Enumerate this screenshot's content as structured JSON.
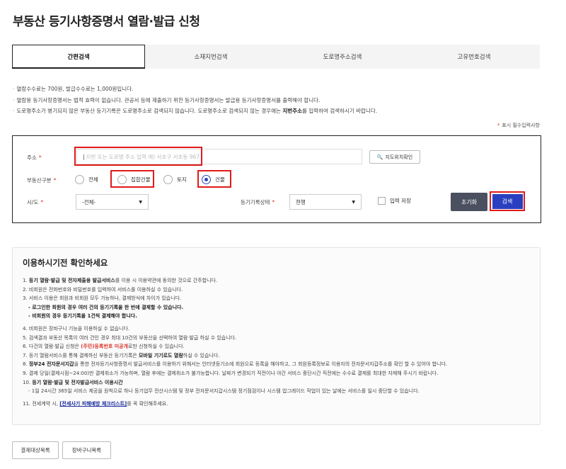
{
  "page": {
    "title": "부동산 등기사항증명서 열람·발급 신청"
  },
  "tabs": [
    {
      "label": "간편검색",
      "active": true
    },
    {
      "label": "소재지번검색",
      "active": false
    },
    {
      "label": "도로명주소검색",
      "active": false
    },
    {
      "label": "고유번호검색",
      "active": false
    }
  ],
  "notes": {
    "n1": "열람수수료는 700원, 발급수수료는 1,000원입니다.",
    "n2": "열람용 등기사항증명서는 법적 효력이 없습니다. 관공서 등에 제출하기 위한 등기사항증명서는 발급용 등기사항증명서를 출력해야 합니다.",
    "n3a": "도로명주소가 병기되지 않은 부동산 등기기록은 도로명주소로 검색되지 않습니다. 도로명주소로 검색되지 않는 경우에는 ",
    "n3b": "지번주소",
    "n3c": "를 입력하여 검색하시기 바랍니다."
  },
  "form": {
    "required_hint": "표시 필수입력사항",
    "address_label": "주소",
    "address_placeholder": "지번 또는 도로명 주소 입력 예) 서초구 서초동 967",
    "map_button": "지도위치확인",
    "type_label": "부동산구분",
    "radios": [
      {
        "label": "전체",
        "checked": false
      },
      {
        "label": "집합건물",
        "checked": false
      },
      {
        "label": "토지",
        "checked": false
      },
      {
        "label": "건물",
        "checked": true
      }
    ],
    "region_label": "시/도",
    "region_value": "-전체-",
    "status_label": "등기기록상태",
    "status_value": "현행",
    "save_label": "입력 저장",
    "reset_button": "초기화",
    "search_button": "검색"
  },
  "guide": {
    "title": "이용하시기전 확인하세요",
    "l1a": "1. ",
    "l1b": "등기 열람·발급 및 전자제출용 발급서비스",
    "l1c": "를 이용 시 이용약관에 동의한 것으로 간주합니다.",
    "l2": "2. 비회원은 전화번호와 비밀번호를 입력하여 서비스를 이용하실 수 있습니다.",
    "l3": "3. 서비스 이용은 회원과 비회원 모두 가능하나, 결제방식에 차이가 있습니다.",
    "l3s1": "- 로그인한 회원의 경우 여러 건의 등기기록을 한 번에 결제할 수 있습니다.",
    "l3s2": "- 비회원의 경우 등기기록을 1건씩 결제해야 합니다.",
    "l4": "4. 비회원은 장바구니 기능을 이용하실 수 없습니다.",
    "l5": "5. 검색결과 부동산 목록이 여러 건인 경우 최대 10건의 부동산을 선택하여 열람·발급 하실 수 있습니다.",
    "l6a": "6. 다건의 열람·발급 신청은 ",
    "l6b": "(주민)등록번호 미공개",
    "l6c": "로만 신청하실 수 있습니다.",
    "l7a": "7. 등기 열람서비스를 통해 결제하신 부동산 등기기록은 ",
    "l7b": "모바일 기기로도 열람",
    "l7c": "하실 수 있습니다.",
    "l8a": "8. ",
    "l8b": "정부24 전자문서지갑",
    "l8c": "을 통한 전자등기사항증명서 발급서비스를 이용하기 위해서는 인터넷등기소에 회원으로 등록을 해야하고, 그 회원등록정보로 이용자의 전자문서지갑주소를 확인 할 수 있어야 합니다.",
    "l9": "9. 결제 당일(결제시점~24:00)만 결제취소가 가능하며, 열람 후에는 결제취소가 불가능합니다. 날짜가 변경되기 직전이나 야간 서비스 중단시간 직전에는 수수료 결제를 최대한 자제해 주시기 바랍니다.",
    "l10a": "10. ",
    "l10b": "등기 열람·발급 및 전자발급서비스 이용시간",
    "l10s": "- 1일 24시간 365일 서비스 제공을 원칙으로 하나 등기업무 전산시스템 및 정부 전자문서지갑시스템 정기점검이나 시스템 업그레이드 작업이 있는 날에는 서비스를 일시 중단할 수 있습니다.",
    "l11a": "11. 전세계약 시, ",
    "l11b": "[전세사기 피해예방 체크리스트]",
    "l11c": "를 꼭 확인해주세요."
  },
  "bottom": {
    "btn1": "결제대상목록",
    "btn2": "장바구니목록"
  },
  "colors": {
    "primary": "#2a3fc0",
    "highlight": "#e01a1a",
    "required": "#d9362c",
    "reset": "#4a5060"
  }
}
